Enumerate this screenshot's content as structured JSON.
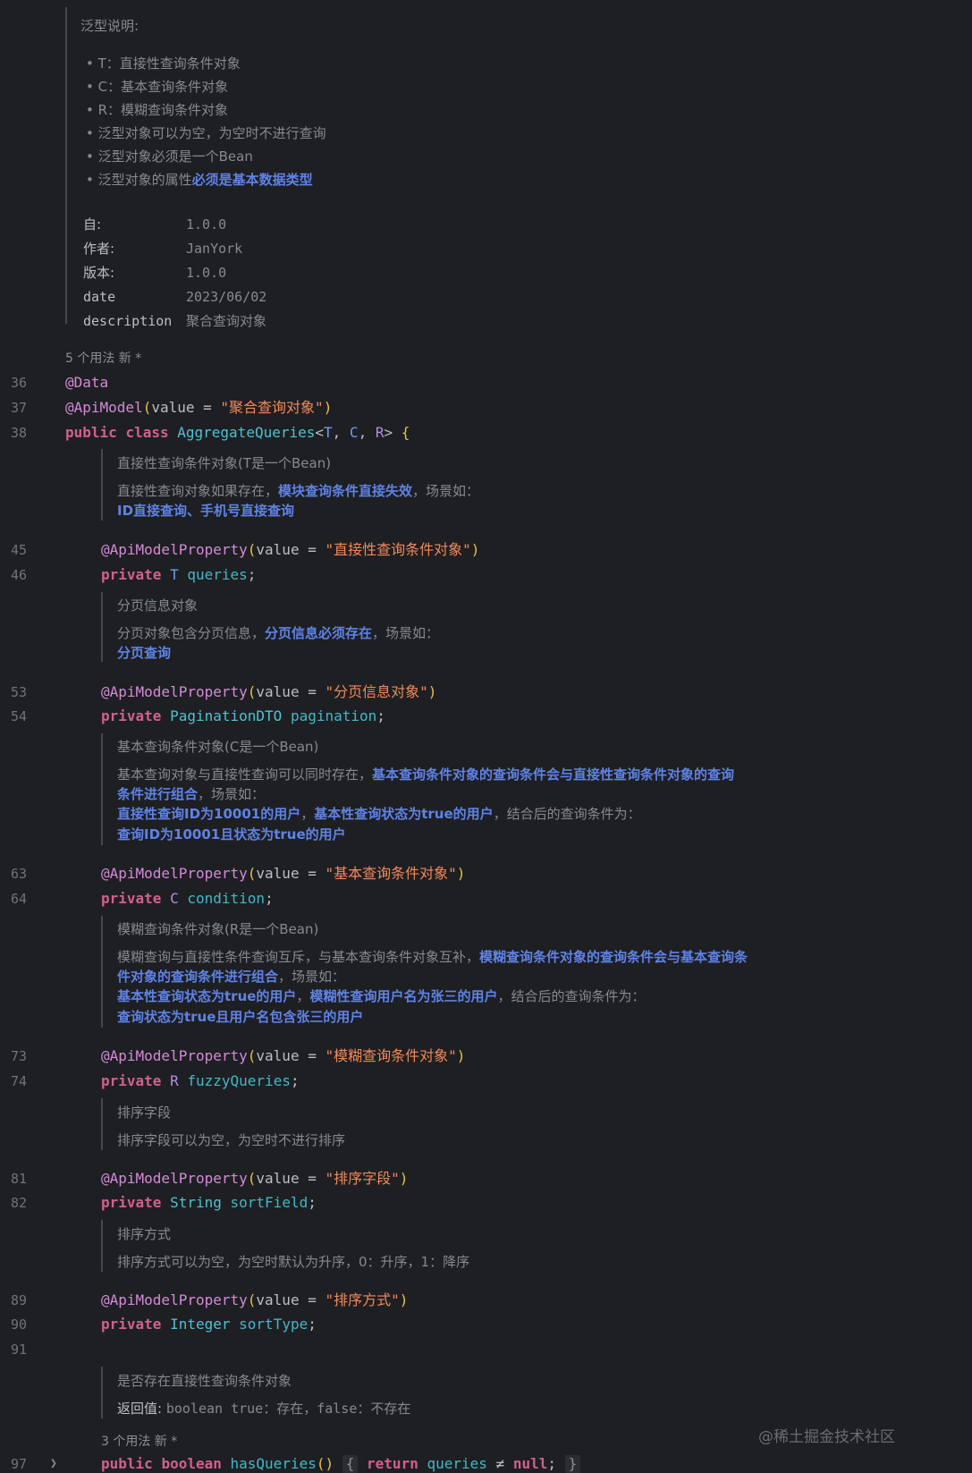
{
  "header_doc": {
    "title": "泛型说明:",
    "bullets": [
      "T：直接性查询条件对象",
      "C：基本查询条件对象",
      "R：模糊查询条件对象",
      "泛型对象可以为空，为空时不进行查询",
      "泛型对象必须是一个Bean"
    ],
    "last_bullet_prefix": "泛型对象的属性",
    "last_bullet_highlight": "必须是基本数据类型",
    "tags": [
      {
        "k": "自:",
        "v": "1.0.0"
      },
      {
        "k": "作者:",
        "v": "JanYork"
      },
      {
        "k": "版本:",
        "v": "1.0.0"
      },
      {
        "k": "date",
        "v": "2023/06/02"
      },
      {
        "k": "description",
        "v": "聚合查询对象"
      }
    ]
  },
  "usages_top": "5 个用法  新 *",
  "lines": {
    "l36": "36",
    "l37": "37",
    "l38": "38",
    "l45": "45",
    "l46": "46",
    "l53": "53",
    "l54": "54",
    "l63": "63",
    "l64": "64",
    "l73": "73",
    "l74": "74",
    "l81": "81",
    "l82": "82",
    "l89": "89",
    "l90": "90",
    "l91": "91",
    "l97": "97"
  },
  "code": {
    "data_ann": "@Data",
    "api_model": "@ApiModel",
    "value_eq": "value = ",
    "api_model_str": "\"聚合查询对象\"",
    "public": "public",
    "class": "class",
    "class_name": "AggregateQueries",
    "tp_t": "T",
    "tp_c": "C",
    "tp_r": "R",
    "amp": "@ApiModelProperty",
    "private": "private",
    "s45": "\"直接性查询条件对象\"",
    "f46_name": "queries",
    "s53": "\"分页信息对象\"",
    "t54": "PaginationDTO",
    "f54_name": "pagination",
    "s63": "\"基本查询条件对象\"",
    "f64_name": "condition",
    "s73": "\"模糊查询条件对象\"",
    "f74_name": "fuzzyQueries",
    "s81": "\"排序字段\"",
    "t82": "String",
    "f82_name": "sortField",
    "s89": "\"排序方式\"",
    "t90": "Integer",
    "f90_name": "sortType",
    "boolean": "boolean",
    "method": "hasQueries",
    "return": "return",
    "ret_field": "queries",
    "neq": "≠",
    "null": "null"
  },
  "docs": {
    "d1_title": "直接性查询条件对象(T是一个Bean)",
    "d1_a": "直接性查询对象如果存在，",
    "d1_b": "模块查询条件直接失效",
    "d1_c": "，场景如：",
    "d1_d": "ID直接查询、手机号直接查询",
    "d2_title": "分页信息对象",
    "d2_a": "分页对象包含分页信息，",
    "d2_b": "分页信息必须存在",
    "d2_c": "，场景如：",
    "d2_d": "分页查询",
    "d3_title": "基本查询条件对象(C是一个Bean)",
    "d3_a": "基本查询对象与直接性查询可以同时存在，",
    "d3_b": "基本查询条件对象的查询条件会与直接性查询条件对象的查询",
    "d3_c": "条件进行组合",
    "d3_d": "，场景如：",
    "d3_e": "直接性查询ID为10001的用户",
    "d3_f": "，",
    "d3_g": "基本性查询状态为true的用户",
    "d3_h": "，结合后的查询条件为：",
    "d3_i": "查询ID为10001且状态为true的用户",
    "d4_title": "模糊查询条件对象(R是一个Bean)",
    "d4_a": "模糊查询与直接性条件查询互斥，与基本查询条件对象互补，",
    "d4_b": "模糊查询条件对象的查询条件会与基本查询条",
    "d4_c": "件对象的查询条件进行组合",
    "d4_d": "，场景如：",
    "d4_e": "基本性查询状态为true的用户",
    "d4_f": "，",
    "d4_g": "模糊性查询用户名为张三的用户",
    "d4_h": "，结合后的查询条件为：",
    "d4_i": "查询状态为true且用户名包含张三的用户",
    "d5_title": "排序字段",
    "d5_a": "排序字段可以为空，为空时不进行排序",
    "d6_title": "排序方式",
    "d6_a": "排序方式可以为空，为空时默认为升序，0：升序，1：降序",
    "d7_title": "是否存在直接性查询条件对象",
    "d7_label": "返回值:",
    "d7_a": "boolean true：存在，false：不存在"
  },
  "usages_bottom": "3 个用法  新 *",
  "watermark": "@稀土掘金技术社区",
  "colors": {
    "background": "#1e1f22",
    "keyword": "#d1608f",
    "annotation": "#d48ad9",
    "string": "#f2895a",
    "field": "#41b8c9",
    "doc_highlight": "#5f82e6"
  }
}
